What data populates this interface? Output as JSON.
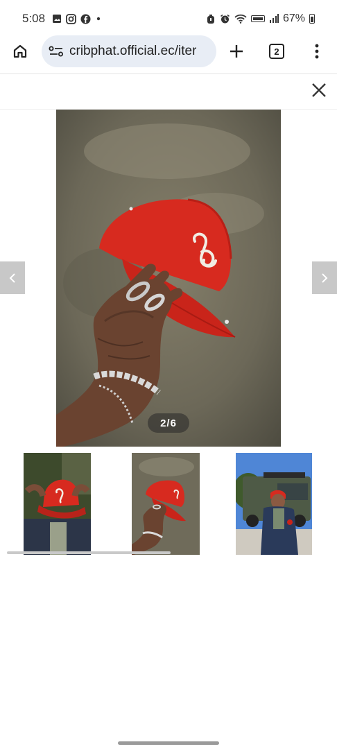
{
  "status_bar": {
    "time": "5:08",
    "battery": "67%",
    "left_icons": [
      "gallery-icon",
      "instagram-icon",
      "facebook-icon",
      "dot-icon"
    ],
    "right_icons": [
      "alarm-icon",
      "alarm-clock-icon",
      "wifi-icon",
      "volte-icon",
      "signal-icon",
      "battery-icon"
    ]
  },
  "browser": {
    "url": "cribphat.official.ec/iter",
    "tab_count": "2"
  },
  "gallery": {
    "counter": "2/6",
    "current_index": 2,
    "total": 6
  },
  "colors": {
    "cap_red": "#d72a1f",
    "omnibox_bg": "#e8edf5",
    "nav_arrow_bg": "#c8c8c8"
  }
}
